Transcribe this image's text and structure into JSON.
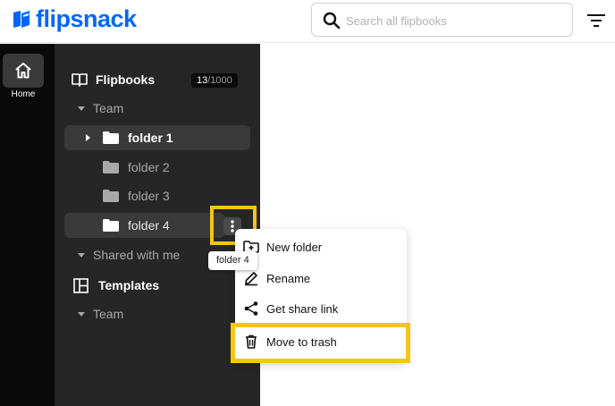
{
  "header": {
    "brand": "flipsnack",
    "search_placeholder": "Search all flipbooks",
    "brand_color": "#0066ff"
  },
  "rail": {
    "home_label": "Home"
  },
  "sidebar": {
    "flipbooks_label": "Flipbooks",
    "count_used": "13",
    "count_total": "/1000",
    "team_label": "Team",
    "folders": [
      {
        "label": "folder 1",
        "selected": true
      },
      {
        "label": "folder 2"
      },
      {
        "label": "folder 3"
      },
      {
        "label": "folder 4",
        "hovered": true
      }
    ],
    "shared_label": "Shared with me",
    "templates_label": "Templates",
    "templates_team_label": "Team"
  },
  "tooltip": {
    "text": "folder 4"
  },
  "context_menu": {
    "items": [
      {
        "label": "New folder",
        "icon": "folder-plus-icon"
      },
      {
        "label": "Rename",
        "icon": "pencil-icon"
      },
      {
        "label": "Get share link",
        "icon": "share-icon"
      },
      {
        "label": "Move to trash",
        "icon": "trash-icon"
      }
    ]
  },
  "highlight_color": "#f5c518"
}
